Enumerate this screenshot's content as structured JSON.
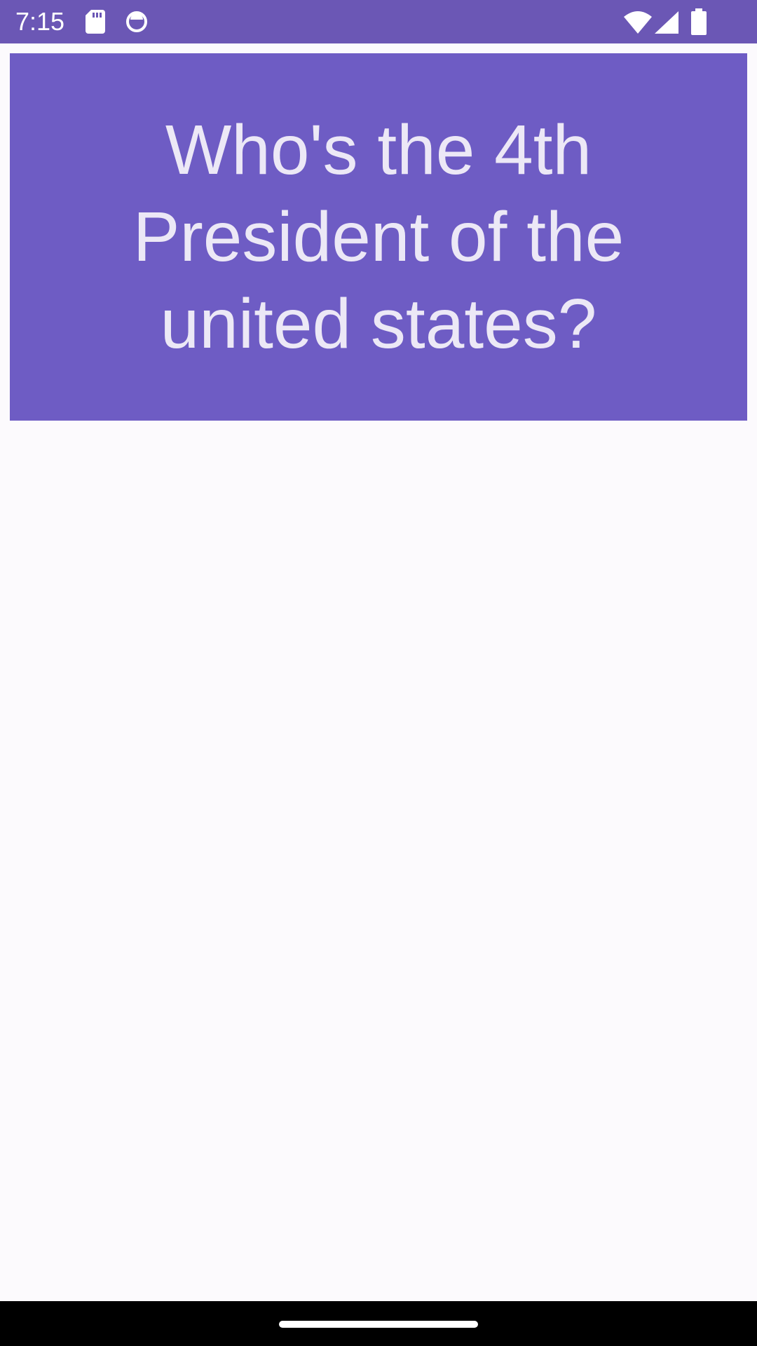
{
  "status_bar": {
    "time": "7:15",
    "icons": [
      "sd-card-icon",
      "sync-circle-icon",
      "wifi-icon",
      "cell-signal-icon",
      "battery-icon"
    ],
    "background_color": "#6b57b5"
  },
  "question": {
    "text": "Who's the 4th President of the united states?",
    "background_color": "#6e5cc4",
    "text_color": "#ece8f6"
  },
  "nav_bar": {
    "icons": [
      "home-handle-icon"
    ]
  }
}
